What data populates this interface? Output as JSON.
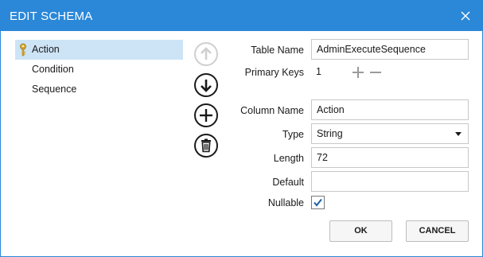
{
  "dialog": {
    "title": "EDIT SCHEMA"
  },
  "fields": [
    {
      "label": "Action",
      "selected": true,
      "is_key": true
    },
    {
      "label": "Condition",
      "selected": false,
      "is_key": false
    },
    {
      "label": "Sequence",
      "selected": false,
      "is_key": false
    }
  ],
  "form": {
    "table_name_label": "Table Name",
    "table_name_value": "AdminExecuteSequence",
    "primary_keys_label": "Primary Keys",
    "primary_keys_value": "1",
    "column_name_label": "Column Name",
    "column_name_value": "Action",
    "type_label": "Type",
    "type_value": "String",
    "length_label": "Length",
    "length_value": "72",
    "default_label": "Default",
    "default_value": "",
    "nullable_label": "Nullable",
    "nullable_checked": true
  },
  "buttons": {
    "ok": "OK",
    "cancel": "CANCEL"
  },
  "icons": {
    "close": "close-icon",
    "key": "key-icon",
    "move_up": "arrow-up-icon",
    "move_down": "arrow-down-icon",
    "add": "plus-icon",
    "delete": "trash-icon",
    "increment": "plus-icon",
    "decrement": "minus-icon"
  },
  "colors": {
    "accent": "#2b88d8",
    "selection": "#cde4f7",
    "checkmark": "#1e5fa8"
  }
}
